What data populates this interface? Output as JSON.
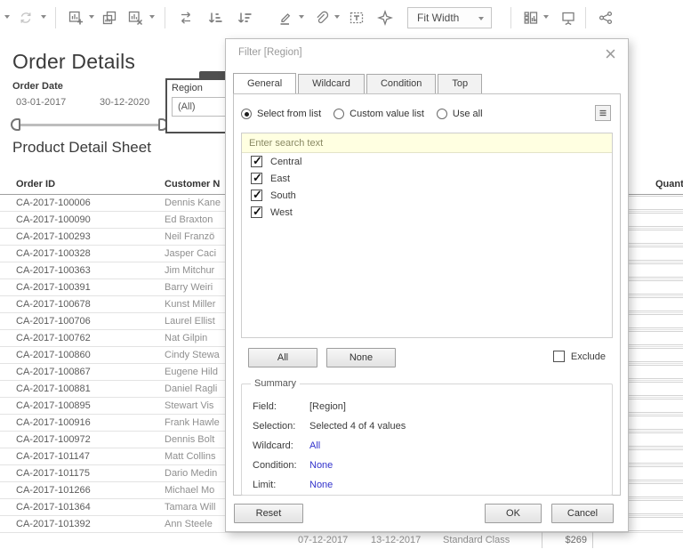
{
  "toolbar": {
    "fit_mode": "Fit Width",
    "icons": [
      "dropdown-caret",
      "refresh",
      "dropdown-caret",
      "new-worksheet",
      "duplicate-worksheet",
      "clear-sheet",
      "swap-rows-columns",
      "sort-ascending",
      "sort-descending",
      "highlight",
      "paperclip",
      "text-label",
      "pin",
      "fit-selector",
      "show-cards",
      "presentation-mode",
      "share"
    ]
  },
  "sheet": {
    "title": "Order Details",
    "order_date_filter": {
      "label": "Order Date",
      "start": "03-01-2017",
      "end": "30-12-2020"
    },
    "region_filter_card": {
      "label": "Region",
      "value": "(All)"
    },
    "table": {
      "title": "Product Detail Sheet",
      "headers": {
        "order_id": "Order ID",
        "customer": "Customer N",
        "quantity": "Quant"
      },
      "rows": [
        {
          "order_id": "CA-2017-100006",
          "customer": "Dennis Kane"
        },
        {
          "order_id": "CA-2017-100090",
          "customer": "Ed Braxton"
        },
        {
          "order_id": "CA-2017-100293",
          "customer": "Neil Franzö"
        },
        {
          "order_id": "CA-2017-100328",
          "customer": "Jasper Caci"
        },
        {
          "order_id": "CA-2017-100363",
          "customer": "Jim Mitchur"
        },
        {
          "order_id": "CA-2017-100391",
          "customer": "Barry Weiri"
        },
        {
          "order_id": "CA-2017-100678",
          "customer": "Kunst Miller"
        },
        {
          "order_id": "CA-2017-100706",
          "customer": "Laurel Ellist"
        },
        {
          "order_id": "CA-2017-100762",
          "customer": "Nat Gilpin"
        },
        {
          "order_id": "CA-2017-100860",
          "customer": "Cindy Stewa"
        },
        {
          "order_id": "CA-2017-100867",
          "customer": "Eugene Hild"
        },
        {
          "order_id": "CA-2017-100881",
          "customer": "Daniel Ragli"
        },
        {
          "order_id": "CA-2017-100895",
          "customer": "Stewart Vis"
        },
        {
          "order_id": "CA-2017-100916",
          "customer": "Frank Hawle"
        },
        {
          "order_id": "CA-2017-100972",
          "customer": "Dennis Bolt"
        },
        {
          "order_id": "CA-2017-101147",
          "customer": "Matt Collins"
        },
        {
          "order_id": "CA-2017-101175",
          "customer": "Dario Medin"
        },
        {
          "order_id": "CA-2017-101266",
          "customer": "Michael Mo"
        },
        {
          "order_id": "CA-2017-101364",
          "customer": "Tamara Will"
        },
        {
          "order_id": "CA-2017-101392",
          "customer": "Ann Steele"
        }
      ],
      "last_row_visible_cells": {
        "order_date": "07-12-2017",
        "ship_date": "13-12-2017",
        "ship_mode": "Standard Class",
        "amount": "$269"
      }
    }
  },
  "dialog": {
    "title": "Filter [Region]",
    "tabs": [
      {
        "label": "General",
        "active": true
      },
      {
        "label": "Wildcard",
        "active": false
      },
      {
        "label": "Condition",
        "active": false
      },
      {
        "label": "Top",
        "active": false
      }
    ],
    "selection_modes": [
      {
        "label": "Select from list",
        "selected": true
      },
      {
        "label": "Custom value list",
        "selected": false
      },
      {
        "label": "Use all",
        "selected": false
      }
    ],
    "search_placeholder": "Enter search text",
    "values": [
      {
        "label": "Central",
        "checked": true
      },
      {
        "label": "East",
        "checked": true
      },
      {
        "label": "South",
        "checked": true
      },
      {
        "label": "West",
        "checked": true
      }
    ],
    "buttons": {
      "all": "All",
      "none": "None",
      "reset": "Reset",
      "ok": "OK",
      "cancel": "Cancel"
    },
    "exclude": {
      "label": "Exclude",
      "checked": false
    },
    "summary": {
      "legend": "Summary",
      "rows": [
        {
          "label": "Field:",
          "value": "[Region]",
          "link": false
        },
        {
          "label": "Selection:",
          "value": "Selected 4 of 4 values",
          "link": false
        },
        {
          "label": "Wildcard:",
          "value": "All",
          "link": true
        },
        {
          "label": "Condition:",
          "value": "None",
          "link": true
        },
        {
          "label": "Limit:",
          "value": "None",
          "link": true
        }
      ]
    }
  },
  "colors": {
    "link_blue": "#3333cc",
    "search_bg": "#ffffe1",
    "card_border": "#4f4f4f",
    "icon_gray": "#7c7c7c"
  }
}
